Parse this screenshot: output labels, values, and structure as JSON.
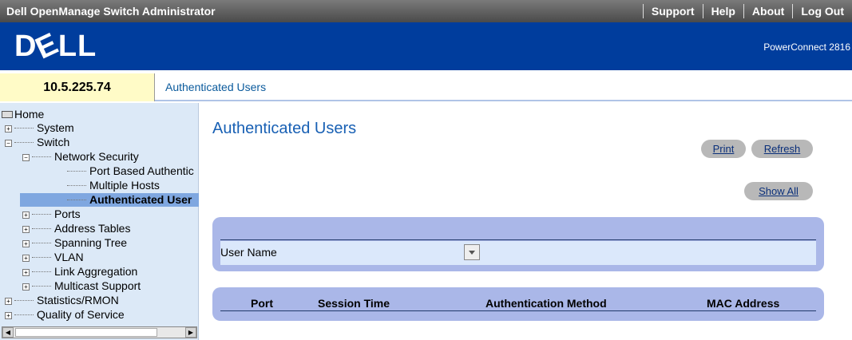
{
  "topbar": {
    "title": "Dell OpenManage Switch Administrator",
    "links": [
      "Support",
      "Help",
      "About",
      "Log Out"
    ]
  },
  "brand": {
    "logo": "DELL",
    "model": "PowerConnect 2816"
  },
  "ip_address": "10.5.225.74",
  "breadcrumb": "Authenticated Users",
  "tree": {
    "home": "Home",
    "system": "System",
    "switch": "Switch",
    "network_security": "Network Security",
    "port_based_auth": "Port Based Authentic",
    "multiple_hosts": "Multiple Hosts",
    "authenticated_users": "Authenticated User",
    "ports": "Ports",
    "address_tables": "Address Tables",
    "spanning_tree": "Spanning Tree",
    "vlan": "VLAN",
    "link_aggregation": "Link Aggregation",
    "multicast_support": "Multicast Support",
    "statistics_rmon": "Statistics/RMON",
    "quality_of_service": "Quality of Service"
  },
  "main": {
    "title": "Authenticated Users",
    "print_label": "Print",
    "refresh_label": "Refresh",
    "show_all_label": "Show All",
    "filter_label": "User Name",
    "table_headers": {
      "port": "Port",
      "session_time": "Session Time",
      "auth_method": "Authentication Method",
      "mac_address": "MAC Address"
    }
  },
  "colors": {
    "brand_blue": "#003d9d",
    "sidebar_bg": "#dce9f7",
    "selected_node": "#7fa7e0",
    "panel": "#aab7e8",
    "ip_box": "#fffbc7"
  }
}
